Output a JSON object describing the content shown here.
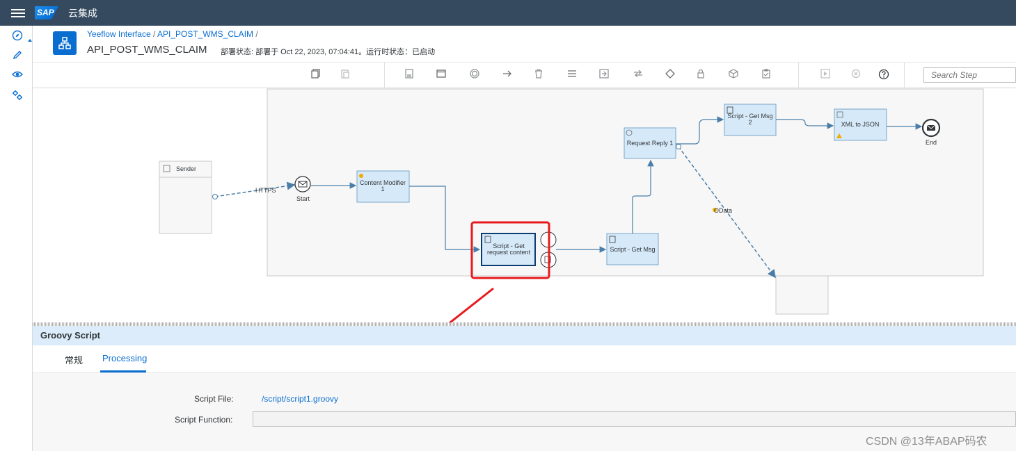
{
  "shell": {
    "logo": "SAP",
    "title": "云集成"
  },
  "leftnav": {
    "items": [
      "discover-icon",
      "design-icon",
      "monitor-icon",
      "settings-icon"
    ]
  },
  "header": {
    "breadcrumb": [
      "Yeeflow Interface",
      "API_POST_WMS_CLAIM"
    ],
    "breadcrumb_sep": "/",
    "title": "API_POST_WMS_CLAIM",
    "status": "部署状态: 部署于 Oct 22, 2023, 07:04:41。运行时状态：已启动"
  },
  "toolbar": {
    "search_placeholder": "Search Step"
  },
  "diagram": {
    "sender": "Sender",
    "https": "HTTPS",
    "start": "Start",
    "content_modifier": [
      "Content Modifier",
      "1"
    ],
    "script_get_request": [
      "Script - Get",
      "request content"
    ],
    "script_get_msg": "Script - Get Msg",
    "request_reply": "Request Reply 1",
    "script_get_msg2": [
      "Script - Get Msg",
      "2"
    ],
    "xml_to_json": "XML to JSON",
    "end": "End",
    "odata": "OData"
  },
  "panel": {
    "title": "Groovy Script",
    "tabs": [
      "常规",
      "Processing"
    ],
    "active_tab": "Processing",
    "script_file_label": "Script File:",
    "script_file_value": "/script/script1.groovy",
    "script_function_label": "Script Function:",
    "script_function_value": ""
  },
  "watermark": "CSDN @13年ABAP码农",
  "colors": {
    "shell": "#354a5f",
    "accent": "#0a6ed1",
    "highlight": "#e8191c",
    "step_fill": "#d6e9f8"
  }
}
